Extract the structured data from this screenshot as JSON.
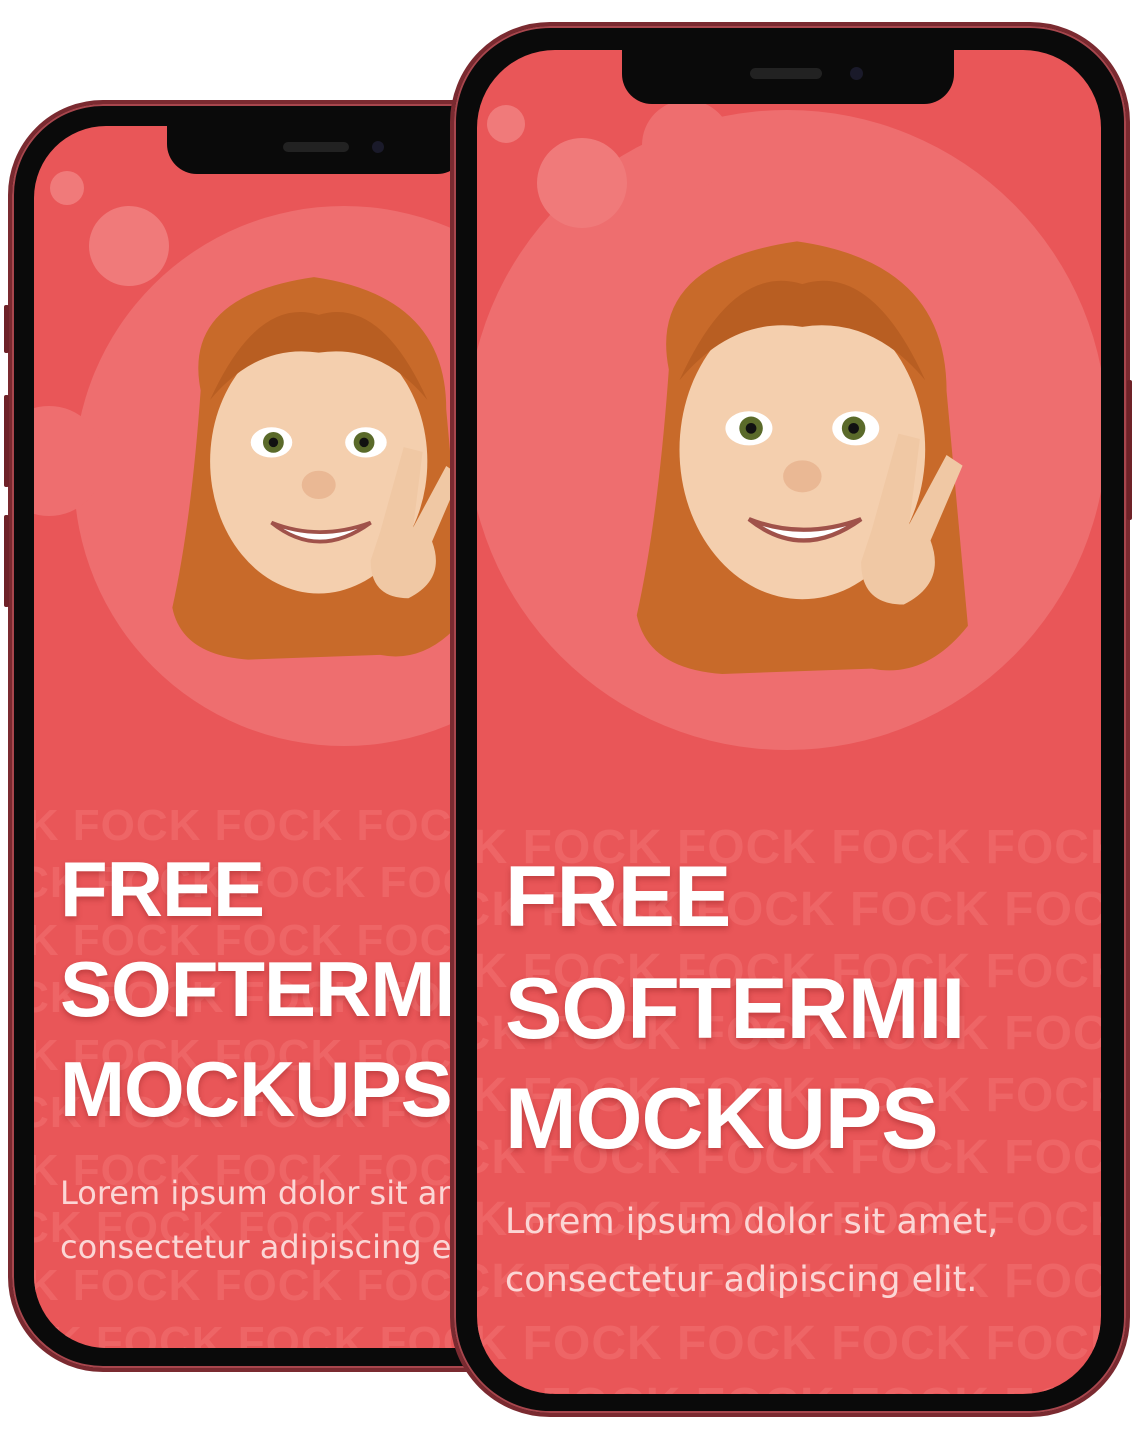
{
  "watermark": "FOCK FOCK FOCK FOCK FOCK FOCK",
  "watermark_offset": "CK FOCK FOCK FOCK FOCK FOCK",
  "title": {
    "line1": "FREE",
    "line2": "SOFTERMII",
    "line3": "MOCKUPS"
  },
  "body": {
    "line1": "Lorem ipsum dolor sit amet,",
    "line2": "consectetur adipiscing elit."
  },
  "colors": {
    "screen": "#e95658",
    "frame": "#7a2a30",
    "accent_circle": "#ee6e6f"
  }
}
